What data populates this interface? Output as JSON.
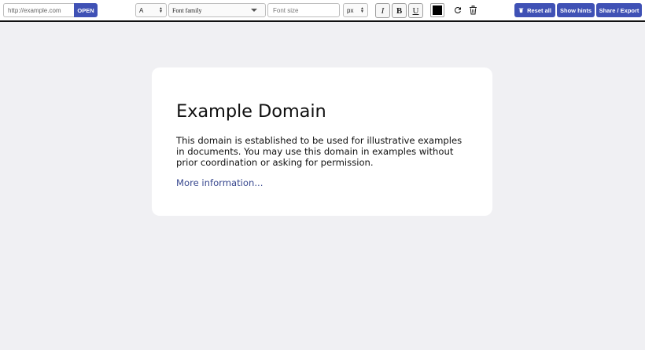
{
  "toolbar": {
    "url_placeholder": "http://example.com",
    "open_label": "OPEN",
    "tag_select_value": "A",
    "font_family_value": "Font family",
    "font_size_placeholder": "Font size",
    "unit_select_value": "px",
    "italic_label": "I",
    "bold_label": "B",
    "underline_label": "U",
    "text_color": "#000000",
    "undo_icon": "redo-arrow-icon",
    "delete_icon": "trash-icon",
    "reset_label": "Reset all",
    "hints_label": "Show hints",
    "share_label": "Share / Export"
  },
  "colors": {
    "accent": "#3f51b5",
    "background": "#f0f0f3",
    "card": "#ffffff",
    "link": "#38488f"
  },
  "page": {
    "title": "Example Domain",
    "description": "This domain is established to be used for illustrative examples in documents. You may use this domain in examples without prior coordination or asking for permission.",
    "link_text": "More information..."
  }
}
